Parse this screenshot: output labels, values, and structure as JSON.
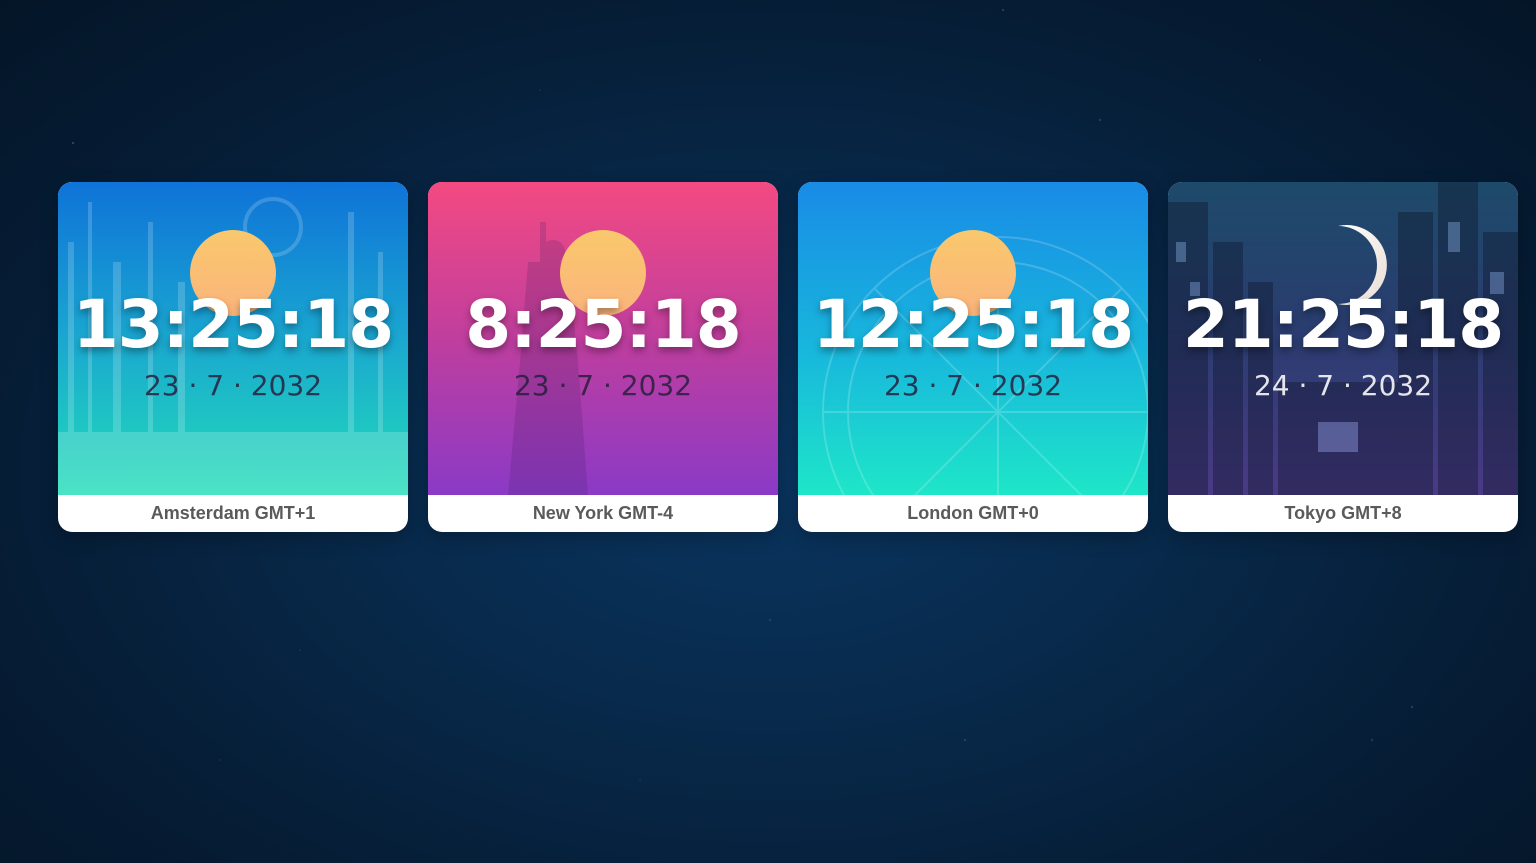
{
  "cards": [
    {
      "city_label": "Amsterdam GMT+1",
      "time": "13:25:18",
      "date": "23 · 7 · 2032",
      "icon": "sun-icon",
      "gradient": [
        "#0f73d8",
        "#22ddb8"
      ]
    },
    {
      "city_label": "New York GMT-4",
      "time": "8:25:18",
      "date": "23 · 7 · 2032",
      "icon": "sun-icon",
      "gradient": [
        "#f34a82",
        "#8a3ac6"
      ]
    },
    {
      "city_label": "London GMT+0",
      "time": "12:25:18",
      "date": "23 · 7 · 2032",
      "icon": "sun-icon",
      "gradient": [
        "#198be6",
        "#1ee6c8"
      ]
    },
    {
      "city_label": "Tokyo GMT+8",
      "time": "21:25:18",
      "date": "24 · 7 · 2032",
      "icon": "moon-icon",
      "gradient": [
        "#1d4a6a",
        "#4a3a86"
      ]
    }
  ],
  "colors": {
    "background": "#072544",
    "sun": "#f9c86c",
    "moon": "#f2ece6",
    "label_text": "#5a5a5a"
  }
}
